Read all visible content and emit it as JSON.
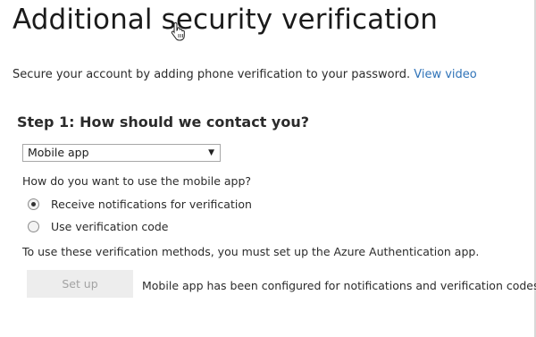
{
  "page": {
    "title": "Additional security verification",
    "intro_text": "Secure your account by adding phone verification to your password.",
    "intro_link": "View video"
  },
  "step1": {
    "title": "Step 1: How should we contact you?",
    "contact_method": {
      "selected": "Mobile app",
      "arrow": "▼"
    },
    "question": "How do you want to use the mobile app?",
    "options": [
      {
        "label": "Receive notifications for verification",
        "checked": true
      },
      {
        "label": "Use verification code",
        "checked": false
      }
    ],
    "note": "To use these verification methods, you must set up the Azure Authentication app.",
    "setup_button": {
      "label": "Set up",
      "enabled": false
    },
    "status": "Mobile app has been configured for notifications and verification codes."
  },
  "colors": {
    "link": "#2f73b8",
    "text": "#2b2b2b",
    "disabled_button_bg": "#ededed",
    "disabled_button_text": "#a3a3a3"
  },
  "icons": {
    "cursor": "hand-pointer-icon",
    "dropdown": "triangle-down-icon"
  }
}
